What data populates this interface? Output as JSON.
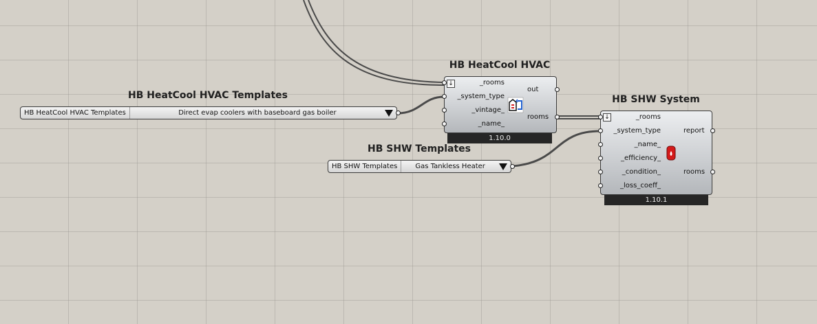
{
  "hvac_templates": {
    "title": "HB HeatCool HVAC Templates",
    "label": "HB HeatCool HVAC Templates",
    "selected": "Direct evap coolers with baseboard gas boiler"
  },
  "hvac": {
    "title": "HB HeatCool HVAC",
    "inputs": [
      "_rooms",
      "_system_type",
      "_vintage_",
      "_name_"
    ],
    "outputs": [
      "out",
      "rooms"
    ],
    "version": "1.10.0"
  },
  "shw_templates": {
    "title": "HB SHW Templates",
    "label": "HB SHW Templates",
    "selected": "Gas Tankless Heater"
  },
  "shw": {
    "title": "HB SHW System",
    "inputs": [
      "_rooms",
      "_system_type",
      "_name_",
      "_efficiency_",
      "_condition_",
      "_loss_coeff_"
    ],
    "outputs": [
      "report",
      "rooms"
    ],
    "version": "1.10.1"
  },
  "icons": {
    "hvac": "hvac-heatcool-icon",
    "shw": "water-heater-icon",
    "dropdown": "chevron-down-icon",
    "load": "load-arrow-icon"
  },
  "colors": {
    "canvas": "#d4d0c8",
    "wire": "#4a4a4a",
    "version_bar": "#262626"
  }
}
